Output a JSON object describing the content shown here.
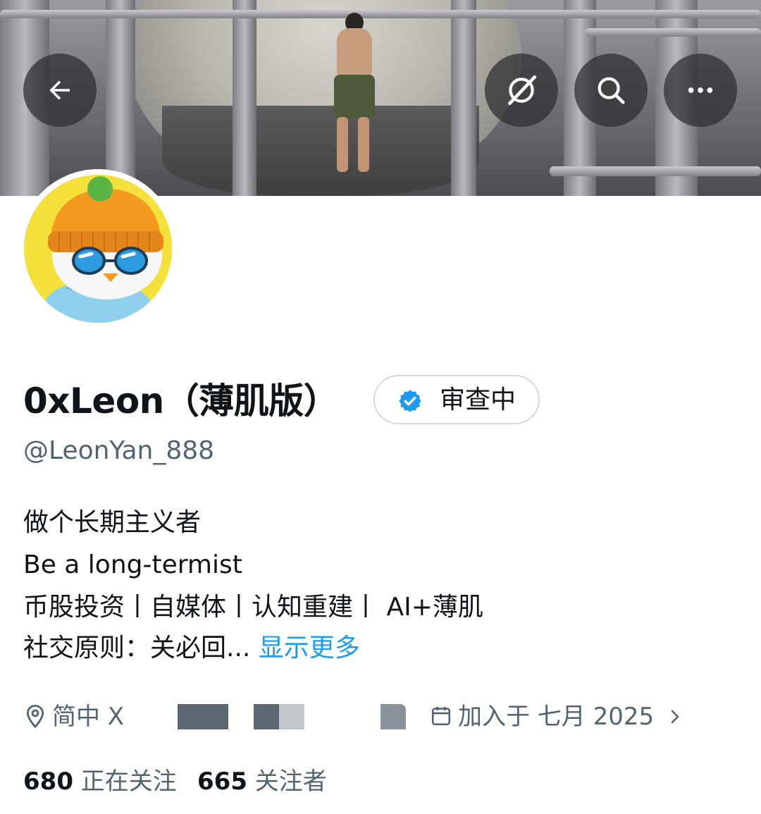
{
  "header": {
    "back_icon": "arrow-left-icon",
    "grok_icon": "grok-slash-circle-icon",
    "search_icon": "search-icon",
    "more_icon": "more-horizontal-icon"
  },
  "profile": {
    "display_name": "0xLeon（薄肌版）",
    "verification_label": "审查中",
    "handle": "@LeonYan_888",
    "bio_lines": [
      "做个长期主义者",
      "Be a long-termist",
      "币股投资丨自媒体丨认知重建丨 AI+薄肌",
      "社交原则：关必回..."
    ],
    "show_more": "显示更多",
    "location": "简中 X",
    "joined": "加入于 七月 2025",
    "following_count": "680",
    "following_label": "正在关注",
    "followers_count": "665",
    "followers_label": "关注者"
  },
  "colors": {
    "accent": "#1d9bf0",
    "secondary_text": "#536471",
    "primary_text": "#0f1419",
    "avatar_bg": "#f4e13c"
  }
}
